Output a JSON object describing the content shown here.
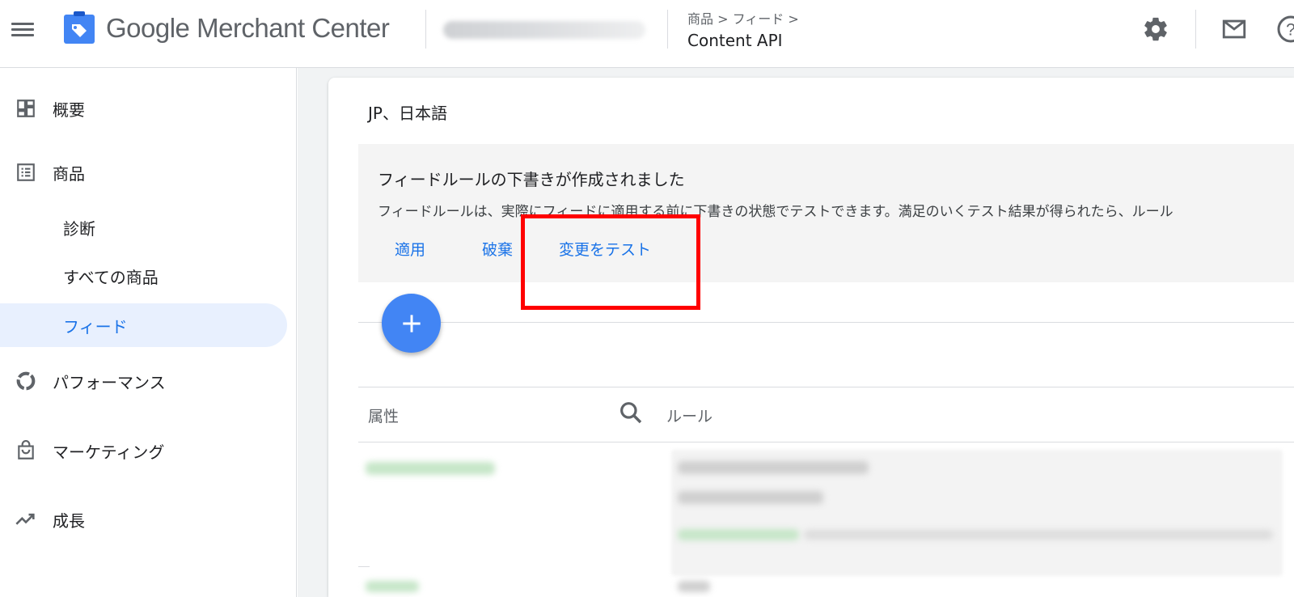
{
  "topbar": {
    "brand_google": "Google",
    "brand_rest": " Merchant Center",
    "breadcrumb": "商品 > フィード >",
    "page_title": "Content API"
  },
  "sidebar": {
    "items": [
      {
        "label": "概要",
        "icon": "dashboard-icon"
      },
      {
        "label": "商品",
        "icon": "list-icon"
      },
      {
        "label": "診断"
      },
      {
        "label": "すべての商品"
      },
      {
        "label": "フィード"
      },
      {
        "label": "パフォーマンス",
        "icon": "donut-chart-icon"
      },
      {
        "label": "マーケティング",
        "icon": "shopping-bag-icon"
      },
      {
        "label": "成長",
        "icon": "trending-up-icon"
      }
    ],
    "active_item": "フィード"
  },
  "main": {
    "card_title": "JP、日本語",
    "banner": {
      "title": "フィードルールの下書きが作成されました",
      "description": "フィードルールは、実際にフィードに適用する前に下書きの状態でテストできます。満足のいくテスト結果が得られたら、ルール",
      "apply_label": "適用",
      "discard_label": "破棄",
      "test_label": "変更をテスト"
    },
    "table": {
      "col_attribute": "属性",
      "col_rule": "ルール"
    }
  },
  "colors": {
    "accent": "#1a73e8",
    "fab": "#4285f4",
    "highlight": "#ff0000",
    "active_nav_bg": "#e8f0fe"
  }
}
